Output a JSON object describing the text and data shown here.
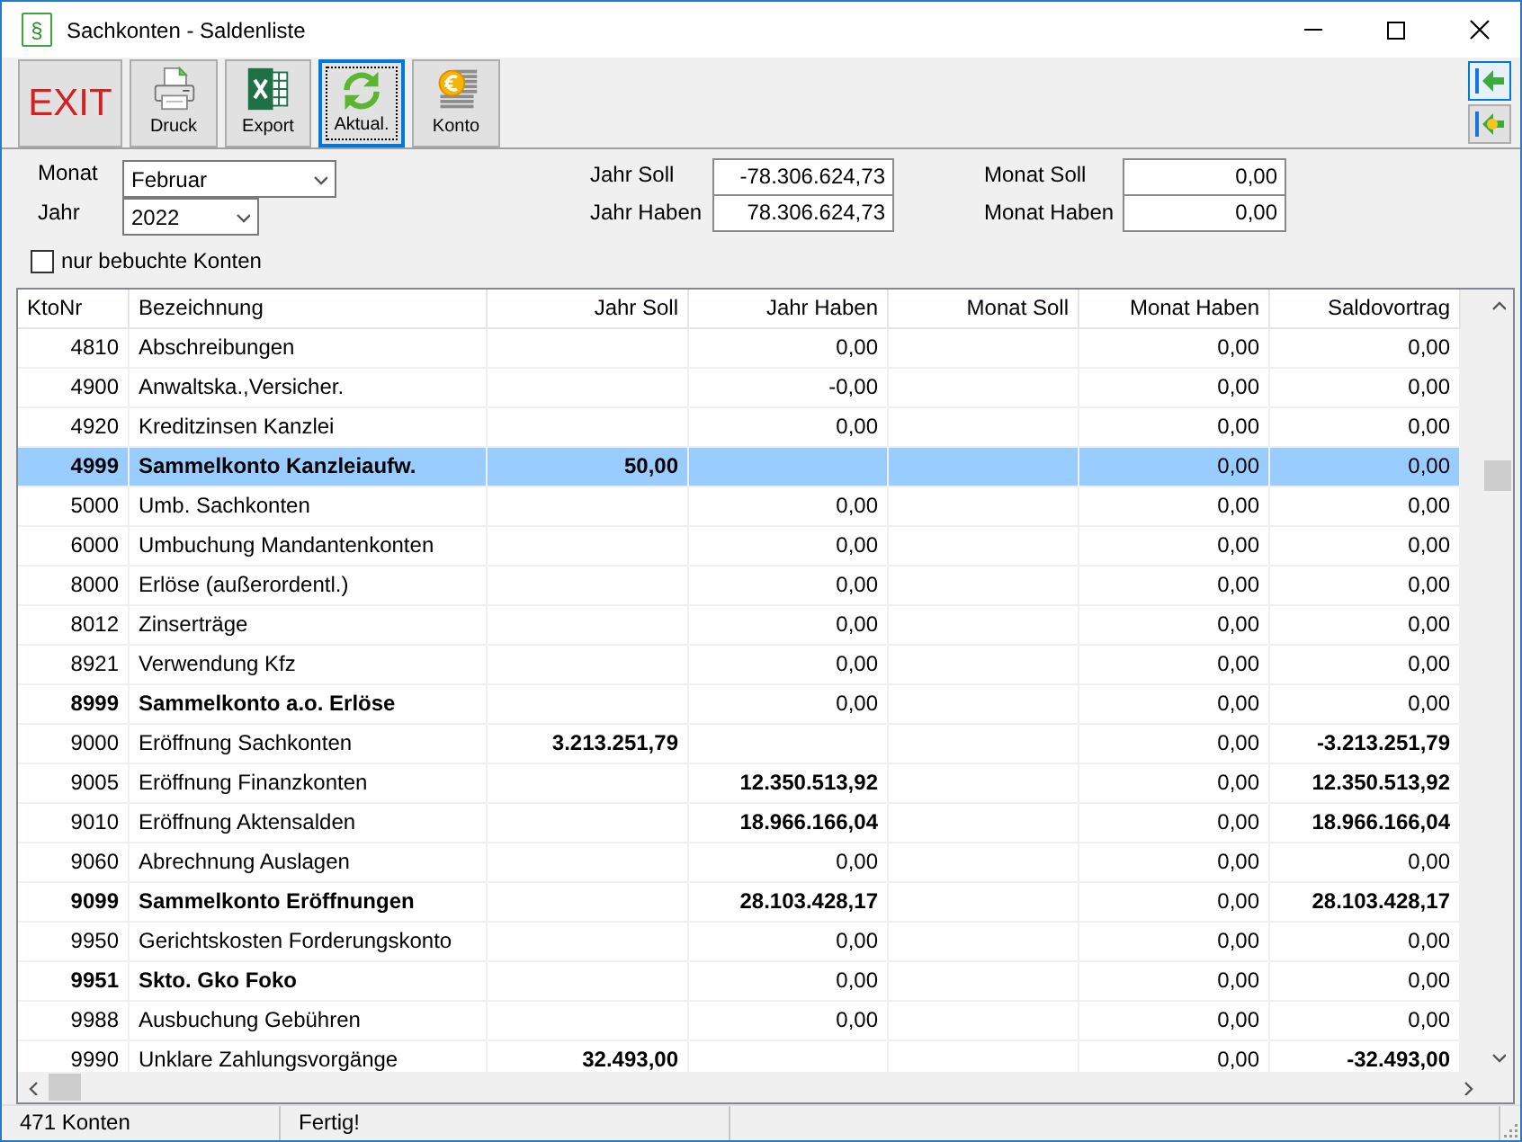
{
  "window": {
    "title": "Sachkonten - Saldenliste",
    "icon_glyph": "§"
  },
  "toolbar": {
    "buttons": [
      {
        "kind": "exit",
        "label": "EXIT",
        "focused": false
      },
      {
        "kind": "print",
        "label": "Druck",
        "focused": false
      },
      {
        "kind": "export",
        "label": "Export",
        "focused": false
      },
      {
        "kind": "refresh",
        "label": "Aktual.",
        "focused": true
      },
      {
        "kind": "account",
        "label": "Konto",
        "focused": false
      }
    ],
    "nav_buttons": [
      {
        "kind": "back",
        "highlighted": true
      },
      {
        "kind": "back_marked",
        "highlighted": false
      }
    ]
  },
  "filters": {
    "month": {
      "label": "Monat",
      "value": "Februar"
    },
    "year": {
      "label": "Jahr",
      "value": "2022"
    },
    "only_booked": {
      "label": "nur bebuchte Konten",
      "checked": false
    }
  },
  "year_totals": [
    {
      "label": "Jahr Soll",
      "value": "-78.306.624,73"
    },
    {
      "label": "Jahr Haben",
      "value": "78.306.624,73"
    }
  ],
  "month_totals": [
    {
      "label": "Monat Soll",
      "value": "0,00"
    },
    {
      "label": "Monat Haben",
      "value": "0,00"
    }
  ],
  "table": {
    "columns": [
      {
        "label": "KtoNr",
        "kind": "number"
      },
      {
        "label": "Bezeichnung",
        "kind": "text"
      },
      {
        "label": "Jahr Soll",
        "kind": "amount"
      },
      {
        "label": "Jahr Haben",
        "kind": "amount"
      },
      {
        "label": "Monat Soll",
        "kind": "amount"
      },
      {
        "label": "Monat Haben",
        "kind": "amount"
      },
      {
        "label": "Saldovortrag",
        "kind": "amount"
      }
    ],
    "rows": [
      {
        "kto_nr": "4810",
        "bezeichnung": "Abschreibungen",
        "jahr_haben": {
          "text": "0,00",
          "bold": false
        },
        "monat_haben": {
          "text": "0,00",
          "bold": false
        },
        "saldovortrag": {
          "text": "0,00",
          "bold": false
        },
        "bold": false,
        "selected": false
      },
      {
        "kto_nr": "4900",
        "bezeichnung": "Anwaltska.,Versicher.",
        "jahr_haben": {
          "text": "-0,00",
          "bold": false
        },
        "monat_haben": {
          "text": "0,00",
          "bold": false
        },
        "saldovortrag": {
          "text": "0,00",
          "bold": false
        },
        "bold": false,
        "selected": false
      },
      {
        "kto_nr": "4920",
        "bezeichnung": "Kreditzinsen Kanzlei",
        "jahr_haben": {
          "text": "0,00",
          "bold": false
        },
        "monat_haben": {
          "text": "0,00",
          "bold": false
        },
        "saldovortrag": {
          "text": "0,00",
          "bold": false
        },
        "bold": false,
        "selected": false
      },
      {
        "kto_nr": "4999",
        "bezeichnung": "Sammelkonto Kanzleiaufw.",
        "jahr_soll": {
          "text": "50,00",
          "bold": true
        },
        "monat_haben": {
          "text": "0,00",
          "bold": false
        },
        "saldovortrag": {
          "text": "0,00",
          "bold": false
        },
        "bold": true,
        "selected": true
      },
      {
        "kto_nr": "5000",
        "bezeichnung": "Umb. Sachkonten",
        "jahr_haben": {
          "text": "0,00",
          "bold": false
        },
        "monat_haben": {
          "text": "0,00",
          "bold": false
        },
        "saldovortrag": {
          "text": "0,00",
          "bold": false
        },
        "bold": false,
        "selected": false
      },
      {
        "kto_nr": "6000",
        "bezeichnung": "Umbuchung Mandantenkonten",
        "jahr_haben": {
          "text": "0,00",
          "bold": false
        },
        "monat_haben": {
          "text": "0,00",
          "bold": false
        },
        "saldovortrag": {
          "text": "0,00",
          "bold": false
        },
        "bold": false,
        "selected": false
      },
      {
        "kto_nr": "8000",
        "bezeichnung": "Erlöse (außerordentl.)",
        "jahr_haben": {
          "text": "0,00",
          "bold": false
        },
        "monat_haben": {
          "text": "0,00",
          "bold": false
        },
        "saldovortrag": {
          "text": "0,00",
          "bold": false
        },
        "bold": false,
        "selected": false
      },
      {
        "kto_nr": "8012",
        "bezeichnung": "Zinserträge",
        "jahr_haben": {
          "text": "0,00",
          "bold": false
        },
        "monat_haben": {
          "text": "0,00",
          "bold": false
        },
        "saldovortrag": {
          "text": "0,00",
          "bold": false
        },
        "bold": false,
        "selected": false
      },
      {
        "kto_nr": "8921",
        "bezeichnung": "Verwendung Kfz",
        "jahr_haben": {
          "text": "0,00",
          "bold": false
        },
        "monat_haben": {
          "text": "0,00",
          "bold": false
        },
        "saldovortrag": {
          "text": "0,00",
          "bold": false
        },
        "bold": false,
        "selected": false
      },
      {
        "kto_nr": "8999",
        "bezeichnung": "Sammelkonto a.o. Erlöse",
        "jahr_haben": {
          "text": "0,00",
          "bold": false
        },
        "monat_haben": {
          "text": "0,00",
          "bold": false
        },
        "saldovortrag": {
          "text": "0,00",
          "bold": false
        },
        "bold": true,
        "selected": false
      },
      {
        "kto_nr": "9000",
        "bezeichnung": "Eröffnung Sachkonten",
        "jahr_soll": {
          "text": "3.213.251,79",
          "bold": true
        },
        "monat_haben": {
          "text": "0,00",
          "bold": false
        },
        "saldovortrag": {
          "text": "-3.213.251,79",
          "bold": true
        },
        "bold": false,
        "selected": false
      },
      {
        "kto_nr": "9005",
        "bezeichnung": "Eröffnung Finanzkonten",
        "jahr_haben": {
          "text": "12.350.513,92",
          "bold": true
        },
        "monat_haben": {
          "text": "0,00",
          "bold": false
        },
        "saldovortrag": {
          "text": "12.350.513,92",
          "bold": true
        },
        "bold": false,
        "selected": false
      },
      {
        "kto_nr": "9010",
        "bezeichnung": "Eröffnung Aktensalden",
        "jahr_haben": {
          "text": "18.966.166,04",
          "bold": true
        },
        "monat_haben": {
          "text": "0,00",
          "bold": false
        },
        "saldovortrag": {
          "text": "18.966.166,04",
          "bold": true
        },
        "bold": false,
        "selected": false
      },
      {
        "kto_nr": "9060",
        "bezeichnung": "Abrechnung Auslagen",
        "jahr_haben": {
          "text": "0,00",
          "bold": false
        },
        "monat_haben": {
          "text": "0,00",
          "bold": false
        },
        "saldovortrag": {
          "text": "0,00",
          "bold": false
        },
        "bold": false,
        "selected": false
      },
      {
        "kto_nr": "9099",
        "bezeichnung": "Sammelkonto Eröffnungen",
        "jahr_haben": {
          "text": "28.103.428,17",
          "bold": true
        },
        "monat_haben": {
          "text": "0,00",
          "bold": false
        },
        "saldovortrag": {
          "text": "28.103.428,17",
          "bold": true
        },
        "bold": true,
        "selected": false
      },
      {
        "kto_nr": "9950",
        "bezeichnung": "Gerichtskosten Forderungskonto",
        "jahr_haben": {
          "text": "0,00",
          "bold": false
        },
        "monat_haben": {
          "text": "0,00",
          "bold": false
        },
        "saldovortrag": {
          "text": "0,00",
          "bold": false
        },
        "bold": false,
        "selected": false
      },
      {
        "kto_nr": "9951",
        "bezeichnung": "Skto. Gko Foko",
        "jahr_haben": {
          "text": "0,00",
          "bold": false
        },
        "monat_haben": {
          "text": "0,00",
          "bold": false
        },
        "saldovortrag": {
          "text": "0,00",
          "bold": false
        },
        "bold": true,
        "selected": false
      },
      {
        "kto_nr": "9988",
        "bezeichnung": "Ausbuchung Gebühren",
        "jahr_haben": {
          "text": "0,00",
          "bold": false
        },
        "monat_haben": {
          "text": "0,00",
          "bold": false
        },
        "saldovortrag": {
          "text": "0,00",
          "bold": false
        },
        "bold": false,
        "selected": false
      },
      {
        "kto_nr": "9990",
        "bezeichnung": "Unklare Zahlungsvorgänge",
        "jahr_soll": {
          "text": "32.493,00",
          "bold": true
        },
        "monat_haben": {
          "text": "0,00",
          "bold": false
        },
        "saldovortrag": {
          "text": "-32.493,00",
          "bold": true
        },
        "bold": false,
        "selected": false
      }
    ]
  },
  "status_bar": {
    "count": "471 Konten",
    "message": "Fertig!"
  }
}
